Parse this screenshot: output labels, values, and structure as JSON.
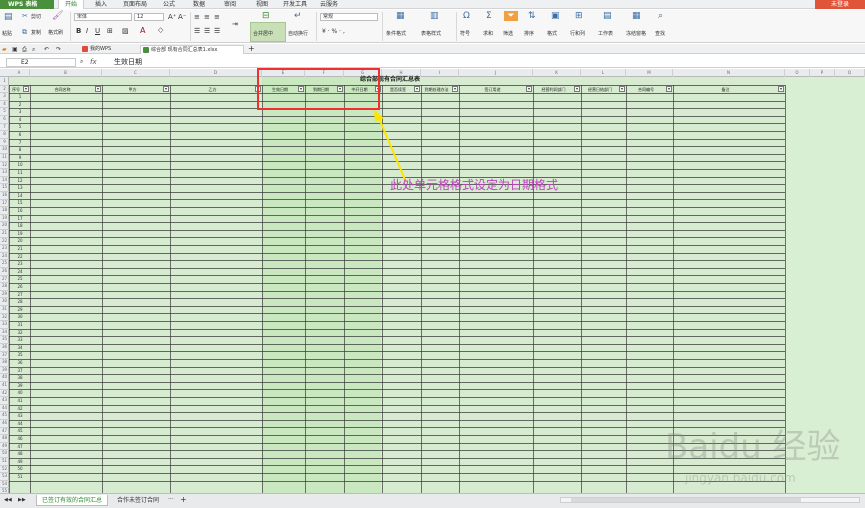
{
  "app": {
    "logo": "WPS 表格",
    "login": "未登录",
    "ribbon_tabs": [
      "开始",
      "插入",
      "页面布局",
      "公式",
      "数据",
      "审阅",
      "视图",
      "开发工具",
      "云服务"
    ],
    "active_tab": "开始"
  },
  "ribbon": {
    "paste": "粘贴",
    "cut": "剪切",
    "copy": "复制",
    "format_painter": "格式刷",
    "font_name": "宋体",
    "font_size": "12",
    "merge_center": "合并居中",
    "auto_wrap": "自动换行",
    "number_format": "常规",
    "conditional_format": "条件格式",
    "table_style": "表格样式",
    "symbol": "符号",
    "sum": "求和",
    "filter": "筛选",
    "sort": "排序",
    "format": "格式",
    "row_col": "行和列",
    "worksheet": "工作表",
    "freeze": "冻结窗格",
    "find": "查找"
  },
  "docbar": {
    "tabs": [
      {
        "label": "我的WPS",
        "color": "#e04a3a"
      },
      {
        "label": "综合部 现有合同汇总表1.xlsx",
        "color": "#4a8f3c"
      }
    ],
    "add": "+"
  },
  "formula_bar": {
    "cell_ref": "E2",
    "fx": "fx",
    "content": "生效日期"
  },
  "sheet": {
    "title": "综合部现有合同汇总表",
    "column_letters": [
      "A",
      "B",
      "C",
      "D",
      "E",
      "F",
      "G",
      "H",
      "I",
      "J",
      "K",
      "L",
      "M",
      "N",
      "O",
      "P",
      "Q"
    ],
    "headers": [
      "序号",
      "合同名称",
      "甲方",
      "乙方",
      "生效日期",
      "到期日期",
      "中开日期",
      "是否续签",
      "到期处理办法",
      "签订用途",
      "经营利润部门",
      "经营日结部门",
      "合同编号",
      "备注"
    ],
    "row_count": 51
  },
  "annotation": "此处单元格格式设定为日期格式",
  "sheet_tabs": [
    "已签订有效的合同汇总",
    "合作未签订合同"
  ],
  "active_sheet": "已签订有效的合同汇总",
  "watermark": {
    "brand": "Baidu 经验",
    "url": "jingyan.baidu.com"
  },
  "colors": {
    "accent": "#4a8f3c",
    "annotation": "#c040c0",
    "highlight": "#f03030",
    "sheet_fill": "#d6ebd0"
  }
}
